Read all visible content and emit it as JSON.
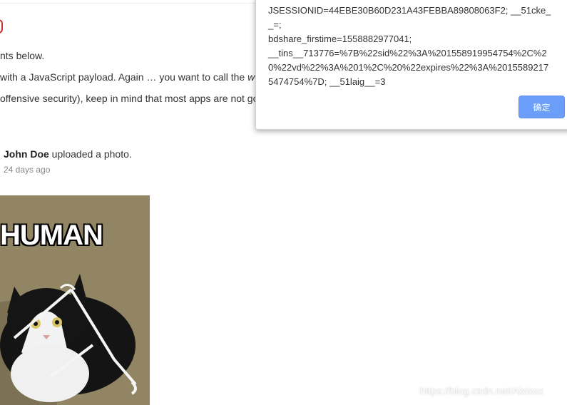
{
  "article": {
    "line1": "nts below.",
    "line2_before": "with a JavaScript payload. Again … you want to call the ",
    "line2_italic": "w",
    "line3": "offensive security), keep in mind that most apps are not go"
  },
  "feed": {
    "user_name": "John Doe",
    "action": " uploaded a photo.",
    "time": "24 days ago",
    "photo_caption": "HUMAN"
  },
  "alert": {
    "message": "JSESSIONID=44EBE30B60D231A43FEBBA89808063F2; __51cke__=;\nbdshare_firstime=1558882977041;\n__tins__713776=%7B%22sid%22%3A%201558919954754%2C%20%22vd%22%3A%201%2C%20%22expires%22%3A%20155892175474754%7D; __51laig__=3",
    "ok_label": "确定"
  },
  "watermark": "https://blog.csdn.net/Aixixxx",
  "colors": {
    "ok_button": "#6a9ef8",
    "photo_bg": "#928563"
  }
}
